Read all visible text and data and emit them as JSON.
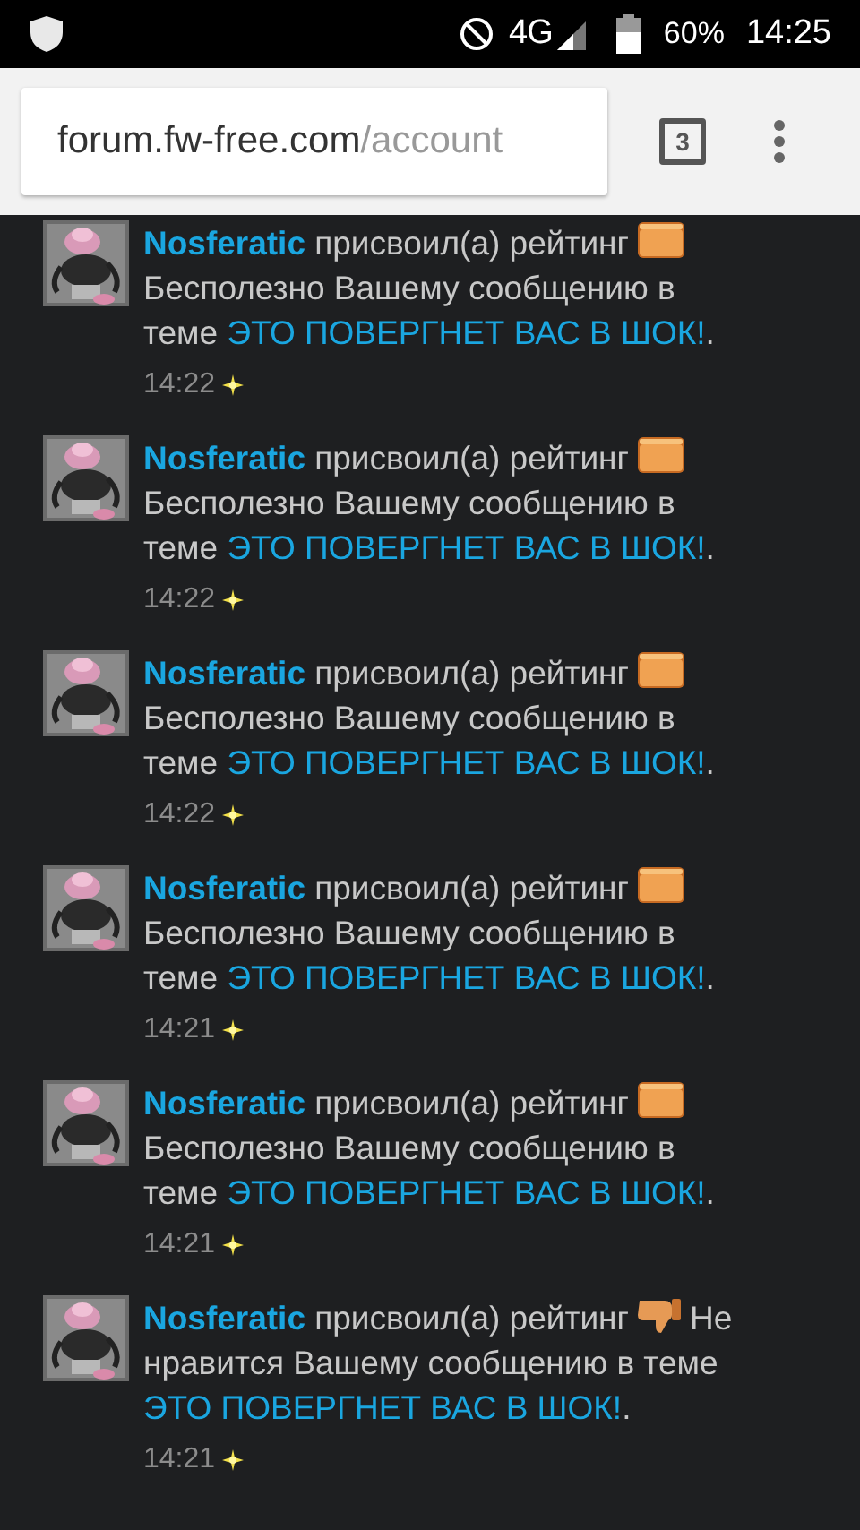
{
  "status_bar": {
    "network": "4G",
    "battery": "60%",
    "time": "14:25"
  },
  "browser": {
    "url_host": "forum.fw-free.com",
    "url_path": "/account",
    "tab_count": "3"
  },
  "alerts": [
    {
      "kind": "useless",
      "user": "Nosferatic",
      "action": "присвоил(а) рейтинг",
      "rating": "Бесполезно",
      "rest": "Вашему сообщению в теме",
      "thread": "ЭТО ПОВЕРГНЕТ ВАС В ШОК!",
      "suffix": ".",
      "time": "14:22",
      "new": true
    },
    {
      "kind": "useless",
      "user": "Nosferatic",
      "action": "присвоил(а) рейтинг",
      "rating": "Бесполезно",
      "rest": "Вашему сообщению в теме",
      "thread": "ЭТО ПОВЕРГНЕТ ВАС В ШОК!",
      "suffix": ".",
      "time": "14:22",
      "new": true
    },
    {
      "kind": "useless",
      "user": "Nosferatic",
      "action": "присвоил(а) рейтинг",
      "rating": "Бесполезно",
      "rest": "Вашему сообщению в теме",
      "thread": "ЭТО ПОВЕРГНЕТ ВАС В ШОК!",
      "suffix": ".",
      "time": "14:22",
      "new": true
    },
    {
      "kind": "useless",
      "user": "Nosferatic",
      "action": "присвоил(а) рейтинг",
      "rating": "Бесполезно",
      "rest": "Вашему сообщению в теме",
      "thread": "ЭТО ПОВЕРГНЕТ ВАС В ШОК!",
      "suffix": ".",
      "time": "14:21",
      "new": true
    },
    {
      "kind": "useless",
      "user": "Nosferatic",
      "action": "присвоил(а) рейтинг",
      "rating": "Бесполезно",
      "rest": "Вашему сообщению в теме",
      "thread": "ЭТО ПОВЕРГНЕТ ВАС В ШОК!",
      "suffix": ".",
      "time": "14:21",
      "new": true
    },
    {
      "kind": "dislike",
      "user": "Nosferatic",
      "action": "присвоил(а) рейтинг",
      "rating": "Не нравится",
      "rest": "Вашему сообщению в теме",
      "thread": "ЭТО ПОВЕРГНЕТ ВАС В ШОК!",
      "suffix": ".",
      "time": "14:21",
      "new": true
    }
  ]
}
